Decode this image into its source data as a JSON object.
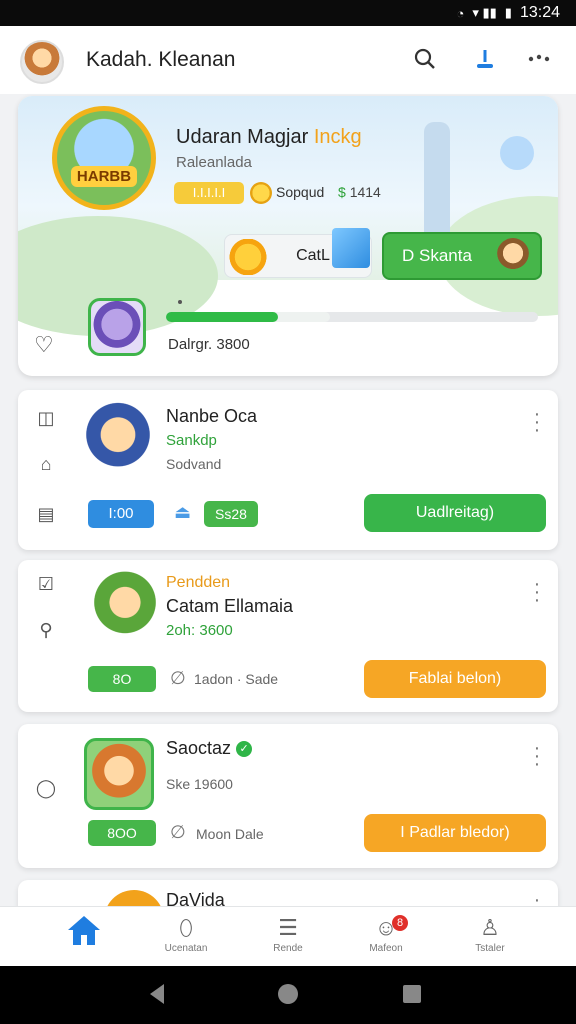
{
  "status_bar": {
    "time": "13:24",
    "signal": "▾ ▮▮",
    "battery": "▮"
  },
  "app_bar": {
    "title": "Kadah. Kleanan"
  },
  "hero": {
    "title_main": "Udaran Magjar ",
    "title_accent": "Inckg",
    "subtitle": "Raleanlada",
    "pill_text": "I.I.I.I.I",
    "coins": "Sopqud",
    "gems_icon": "$",
    "gems_value": "1414",
    "badge": "HARBB",
    "cat_button": "CatL",
    "cta_button": "D Skanta",
    "progress_label": "Dalrgr. 3800",
    "progress": 0.3
  },
  "cards": [
    {
      "title": "Nanbe Oca",
      "green": "Sankdp",
      "gray": "Sodvand",
      "chip_blue": "I:00",
      "chip_green": "Ss28",
      "action": "Uadlreitag)"
    },
    {
      "accent": "Pendden",
      "title": "Catam Ellamaia",
      "green": "2oh: 3600",
      "chip_green": "8O",
      "meta": "1adon · Sade",
      "action": "Fablai belon)"
    },
    {
      "title": "Saoctaz",
      "gray": "Ske 19600",
      "chip_green": "8OO",
      "meta": "Moon Dale",
      "action": "I Padlar bledor)"
    },
    {
      "title": "DaVida"
    }
  ],
  "bottom_nav": [
    {
      "label": "",
      "icon": "home-icon"
    },
    {
      "label": "Ucenatan",
      "icon": "leaf-icon"
    },
    {
      "label": "Rende",
      "icon": "list-icon"
    },
    {
      "label": "Mafeon",
      "icon": "chat-icon",
      "badge": "8"
    },
    {
      "label": "Tstaler",
      "icon": "profile-icon"
    }
  ]
}
